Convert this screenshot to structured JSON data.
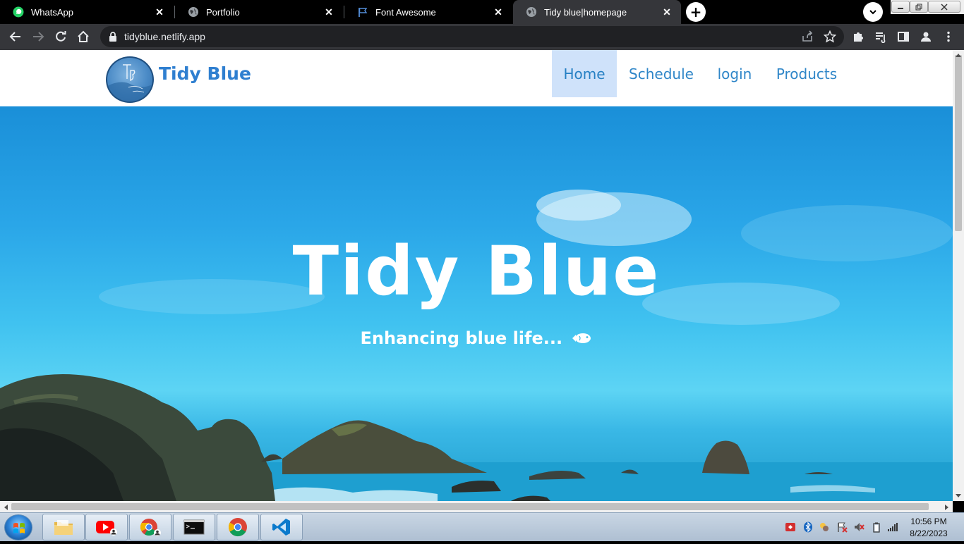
{
  "browser": {
    "tabs": [
      {
        "title": "WhatsApp",
        "icon": "whatsapp-icon",
        "active": false
      },
      {
        "title": "Portfolio",
        "icon": "globe-icon",
        "active": false
      },
      {
        "title": "Font Awesome",
        "icon": "flag-icon",
        "active": false
      },
      {
        "title": "Tidy blue|homepage",
        "icon": "globe-icon",
        "active": true
      }
    ],
    "close_glyph": "✕",
    "new_tab_glyph": "+",
    "address": "tidyblue.netlify.app"
  },
  "site": {
    "brand": "Tidy Blue",
    "nav": [
      {
        "label": "Home",
        "active": true
      },
      {
        "label": "Schedule",
        "active": false
      },
      {
        "label": "login",
        "active": false
      },
      {
        "label": "Products",
        "active": false
      }
    ],
    "hero": {
      "title": "Tidy Blue",
      "subtitle": "Enhancing blue life..."
    }
  },
  "taskbar": {
    "apps": [
      "file-explorer-icon",
      "youtube-icon",
      "chrome-profile-icon",
      "terminal-icon",
      "chrome-icon",
      "vscode-icon"
    ],
    "time": "10:56 PM",
    "date": "8/22/2023"
  },
  "colors": {
    "accent": "#2f86c8",
    "brand": "#2f7fd0",
    "nav_active_bg": "#cfe2fa",
    "chrome_dark": "#35363a"
  }
}
